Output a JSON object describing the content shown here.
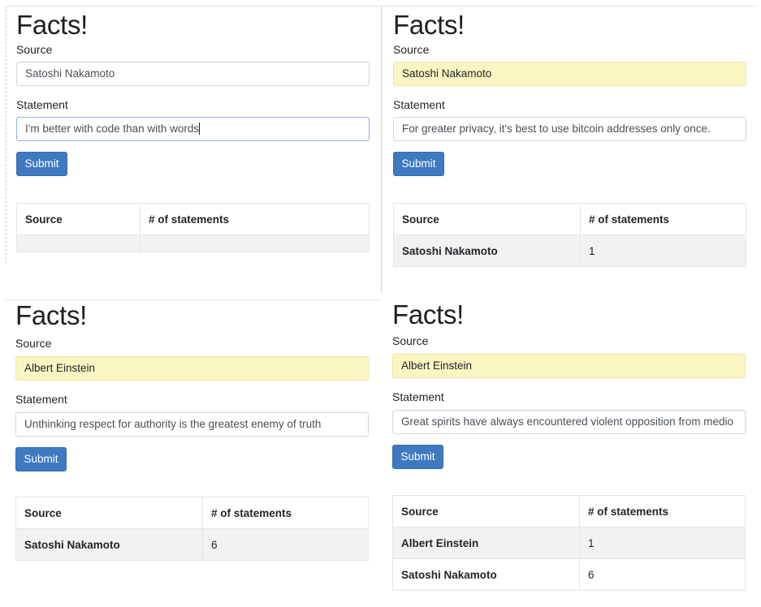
{
  "panels": [
    {
      "title": "Facts!",
      "source_label": "Source",
      "source_value": "Satoshi Nakamoto",
      "statement_label": "Statement",
      "statement_value": "I'm better with code than with words",
      "submit_label": "Submit",
      "table": {
        "headers": [
          "Source",
          "# of statements"
        ],
        "rows": []
      }
    },
    {
      "title": "Facts!",
      "source_label": "Source",
      "source_value": "Satoshi Nakamoto",
      "statement_label": "Statement",
      "statement_value": "For greater privacy, it's best to use bitcoin addresses only once.",
      "submit_label": "Submit",
      "table": {
        "headers": [
          "Source",
          "# of statements"
        ],
        "rows": [
          [
            "Satoshi Nakamoto",
            "1"
          ]
        ]
      }
    },
    {
      "title": "Facts!",
      "source_label": "Source",
      "source_value": "Albert Einstein",
      "statement_label": "Statement",
      "statement_value": "Unthinking respect for authority is the greatest enemy of truth",
      "submit_label": "Submit",
      "table": {
        "headers": [
          "Source",
          "# of statements"
        ],
        "rows": [
          [
            "Satoshi Nakamoto",
            "6"
          ]
        ]
      }
    },
    {
      "title": "Facts!",
      "source_label": "Source",
      "source_value": "Albert Einstein",
      "statement_label": "Statement",
      "statement_value": "Great spirits have always encountered violent opposition from medio",
      "submit_label": "Submit",
      "table": {
        "headers": [
          "Source",
          "# of statements"
        ],
        "rows": [
          [
            "Albert Einstein",
            "1"
          ],
          [
            "Satoshi Nakamoto",
            "6"
          ]
        ]
      }
    }
  ],
  "colors": {
    "autofill_background": "#faf6c2",
    "submit_button": "#3f79c1",
    "table_stripe": "#f2f2f2"
  }
}
